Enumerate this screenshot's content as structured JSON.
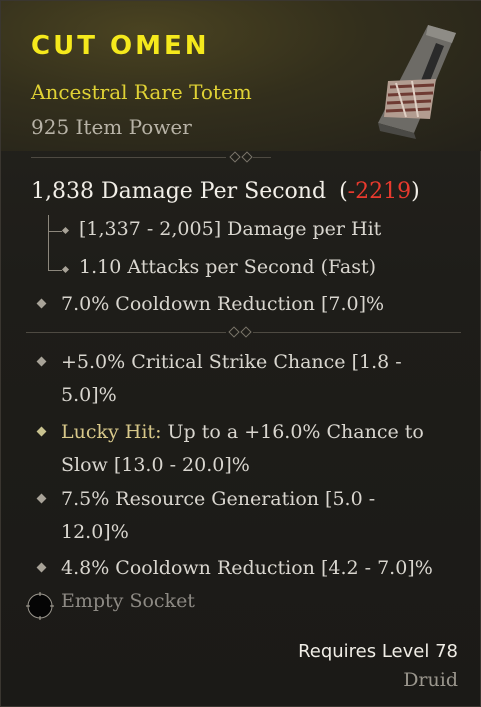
{
  "item": {
    "name": "CUT OMEN",
    "type": "Ancestral Rare Totem",
    "power": "925 Item Power",
    "image_icon": "totem-icon"
  },
  "damage": {
    "dps": "1,838 Damage Per Second",
    "open_paren": "(",
    "delta": "-2219",
    "close_paren": ")",
    "per_hit": "[1,337 - 2,005] Damage per Hit",
    "attack_speed": "1.10 Attacks per Second (Fast)"
  },
  "implicit": {
    "cooldown": "7.0% Cooldown Reduction [7.0]%"
  },
  "affixes": [
    {
      "line1": "+5.0% Critical Strike Chance [1.8 -",
      "line2": "5.0]%"
    },
    {
      "prefix": "Lucky Hit:",
      "line1_rest": " Up to a +16.0% Chance to",
      "line2": "Slow [13.0 - 20.0]%"
    },
    {
      "line1": "7.5% Resource Generation [5.0 -",
      "line2": "12.0]%"
    },
    {
      "line1": "4.8% Cooldown Reduction [4.2 - 7.0]%"
    }
  ],
  "socket": {
    "label": "Empty Socket"
  },
  "requirements": {
    "level": "Requires Level 78",
    "class": "Druid"
  },
  "colors": {
    "name": "#f5e91c",
    "rarity": "#e0d235",
    "negative": "#e83a2e",
    "lucky_hit": "#d8c88a"
  }
}
